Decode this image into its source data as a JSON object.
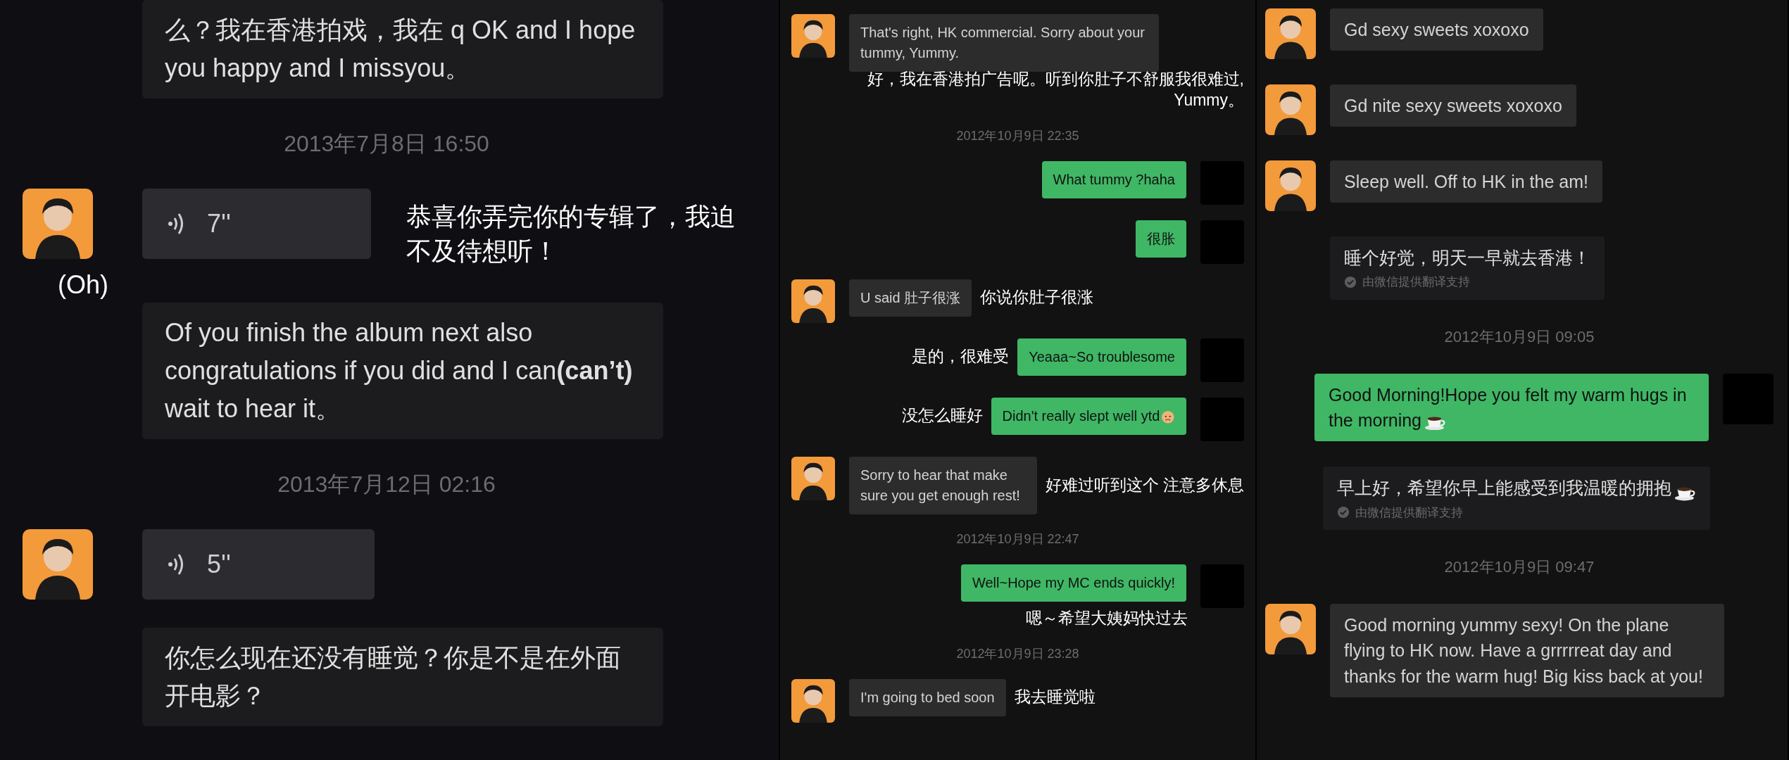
{
  "panels": [
    {
      "messages": [
        {
          "kind": "translation",
          "text": "么？我在香港拍戏，我在 q OK and I hope you happy and I missyou。"
        },
        {
          "kind": "time",
          "text": "2013年7月8日 16:50"
        },
        {
          "kind": "voice",
          "duration": "7''",
          "note": "恭喜你弄完你的专辑了，我迫不及待想听！"
        },
        {
          "kind": "annotation",
          "text": "(Oh)"
        },
        {
          "kind": "translation",
          "text": "Of you finish the album next also congratulations if you did and I can**(can’t)** wait to hear it。"
        },
        {
          "kind": "time",
          "text": "2013年7月12日 02:16"
        },
        {
          "kind": "voice",
          "duration": "5''"
        },
        {
          "kind": "translation",
          "text": "你怎么现在还没有睡觉？你是不是在外面开电影？"
        }
      ]
    },
    {
      "messages": [
        {
          "kind": "incoming",
          "text": "That's right, HK commercial.  Sorry about your tummy, Yummy.",
          "note_below": "好，我在香港拍广告呢。听到你肚子不舒服我很难过, Yummy。"
        },
        {
          "kind": "time",
          "text": "2012年10月9日 22:35"
        },
        {
          "kind": "outgoing",
          "text": "What tummy ?haha"
        },
        {
          "kind": "outgoing",
          "text": "很胀"
        },
        {
          "kind": "incoming",
          "text": "U said 肚子很涨",
          "note_after": "你说你肚子很涨"
        },
        {
          "kind": "outgoing",
          "text": "Yeaaa~So troublesome",
          "note_before": "是的，很难受"
        },
        {
          "kind": "outgoing",
          "text": "Didn't really slept well ytd",
          "emoji": {
            "kind": "face"
          },
          "note_before": "没怎么睡好"
        },
        {
          "kind": "incoming",
          "text": "Sorry to hear that make sure you get enough rest!",
          "note_after": "好难过听到这个 注意多休息"
        },
        {
          "kind": "time",
          "text": "2012年10月9日 22:47"
        },
        {
          "kind": "outgoing",
          "text": "Well~Hope my MC ends quickly!",
          "note_below": "嗯～希望大姨妈快过去"
        },
        {
          "kind": "time",
          "text": "2012年10月9日 23:28"
        },
        {
          "kind": "incoming",
          "text": "I'm going to bed soon",
          "note_after": "我去睡觉啦"
        }
      ]
    },
    {
      "messages": [
        {
          "kind": "incoming",
          "text": "Gd sexy sweets xoxoxo"
        },
        {
          "kind": "incoming",
          "text": "Gd nite sexy sweets xoxoxo"
        },
        {
          "kind": "incoming",
          "text": "Sleep well.  Off to HK in the am!"
        },
        {
          "kind": "translation",
          "text": "睡个好觉，明天一早就去香港！",
          "credit": "由微信提供翻译支持"
        },
        {
          "kind": "time",
          "text": "2012年10月9日 09:05"
        },
        {
          "kind": "outgoing",
          "text": "Good Morning!Hope you felt my warm hugs in the morning",
          "emoji": {
            "kind": "coffee"
          }
        },
        {
          "kind": "sent_translation",
          "text": "早上好，希望你早上能感受到我温暖的拥抱",
          "emoji": {
            "kind": "coffee"
          },
          "credit": "由微信提供翻译支持"
        },
        {
          "kind": "time",
          "text": "2012年10月9日 09:47"
        },
        {
          "kind": "incoming",
          "text": "Good morning yummy sexy!  On the plane flying to HK now.  Have a grrrrreat day and thanks for the warm hug!  Big kiss back at you!"
        }
      ]
    }
  ]
}
